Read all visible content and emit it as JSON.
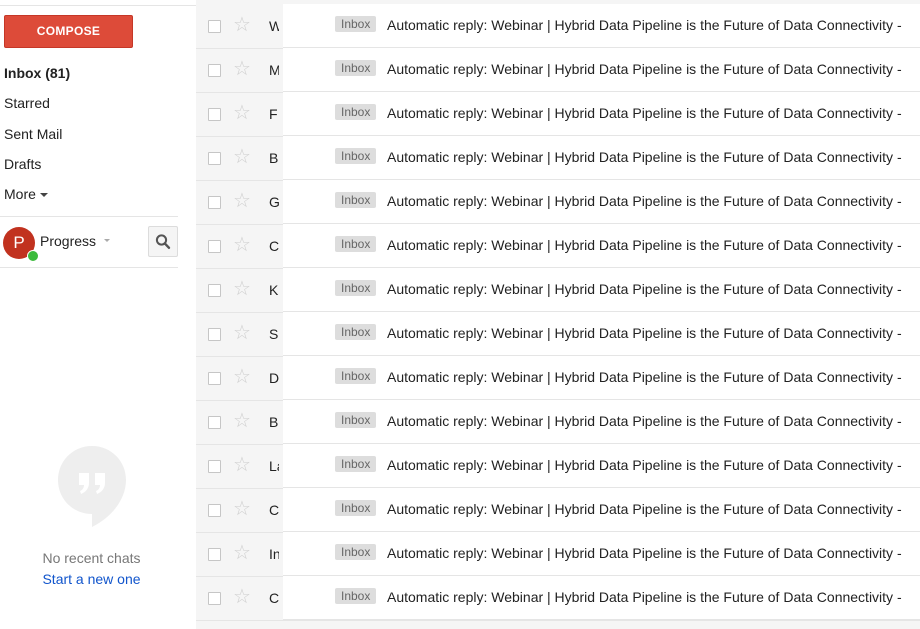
{
  "sidebar": {
    "compose_label": "COMPOSE",
    "nav": [
      {
        "label": "Inbox (81)"
      },
      {
        "label": "Starred"
      },
      {
        "label": "Sent Mail"
      },
      {
        "label": "Drafts"
      },
      {
        "label": "More"
      }
    ],
    "account": {
      "initial": "P",
      "name": "Progress"
    },
    "chat": {
      "empty_text": "No recent chats",
      "start_link": "Start a new one"
    }
  },
  "colors": {
    "compose": "#dd4b39",
    "avatar": "#c1321f",
    "presence": "#3cba3c",
    "link": "#1155cc"
  },
  "icons": [
    "search-icon",
    "star-icon",
    "hangouts-icon",
    "chevron-down-icon"
  ],
  "emails": [
    {
      "sender": "W",
      "label": "Inbox",
      "subject": "Automatic reply: Webinar | Hybrid Data Pipeline is the Future of Data Connectivity -"
    },
    {
      "sender": "M",
      "label": "Inbox",
      "subject": "Automatic reply: Webinar | Hybrid Data Pipeline is the Future of Data Connectivity -"
    },
    {
      "sender": "F",
      "label": "Inbox",
      "subject": "Automatic reply: Webinar | Hybrid Data Pipeline is the Future of Data Connectivity -"
    },
    {
      "sender": "B",
      "label": "Inbox",
      "subject": "Automatic reply: Webinar | Hybrid Data Pipeline is the Future of Data Connectivity -"
    },
    {
      "sender": "G",
      "label": "Inbox",
      "subject": "Automatic reply: Webinar | Hybrid Data Pipeline is the Future of Data Connectivity -"
    },
    {
      "sender": "C",
      "label": "Inbox",
      "subject": "Automatic reply: Webinar | Hybrid Data Pipeline is the Future of Data Connectivity -"
    },
    {
      "sender": "K",
      "label": "Inbox",
      "subject": "Automatic reply: Webinar | Hybrid Data Pipeline is the Future of Data Connectivity -"
    },
    {
      "sender": "S",
      "label": "Inbox",
      "subject": "Automatic reply: Webinar | Hybrid Data Pipeline is the Future of Data Connectivity -"
    },
    {
      "sender": "D",
      "label": "Inbox",
      "subject": "Automatic reply: Webinar | Hybrid Data Pipeline is the Future of Data Connectivity -"
    },
    {
      "sender": "B",
      "label": "Inbox",
      "subject": "Automatic reply: Webinar | Hybrid Data Pipeline is the Future of Data Connectivity -"
    },
    {
      "sender": "La",
      "label": "Inbox",
      "subject": "Automatic reply: Webinar | Hybrid Data Pipeline is the Future of Data Connectivity -"
    },
    {
      "sender": "C",
      "label": "Inbox",
      "subject": "Automatic reply: Webinar | Hybrid Data Pipeline is the Future of Data Connectivity -"
    },
    {
      "sender": "In",
      "label": "Inbox",
      "subject": "Automatic reply: Webinar | Hybrid Data Pipeline is the Future of Data Connectivity -"
    },
    {
      "sender": "C",
      "label": "Inbox",
      "subject": "Automatic reply: Webinar | Hybrid Data Pipeline is the Future of Data Connectivity -"
    }
  ]
}
